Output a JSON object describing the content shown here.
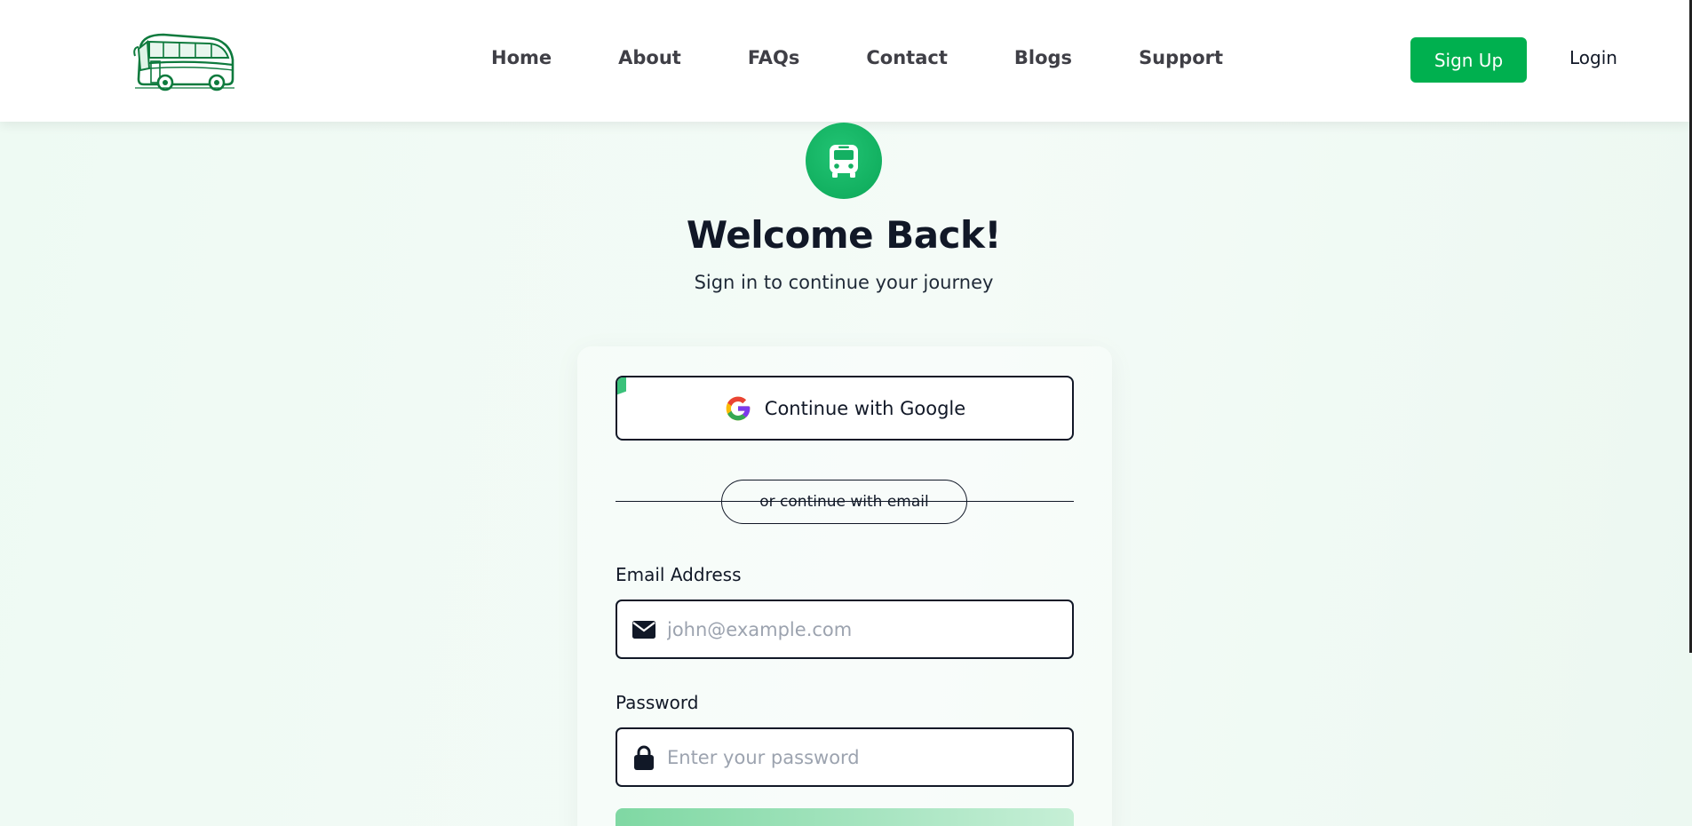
{
  "nav": {
    "links": [
      "Home",
      "About",
      "FAQs",
      "Contact",
      "Blogs",
      "Support"
    ],
    "signup_label": "Sign Up",
    "login_label": "Login"
  },
  "hero": {
    "title": "Welcome Back!",
    "subtitle": "Sign in to continue your journey"
  },
  "form": {
    "google_label": "Continue with Google",
    "divider_text": "or continue with email",
    "email": {
      "label": "Email Address",
      "placeholder": "john@example.com",
      "value": "",
      "icon": "envelope-icon"
    },
    "password": {
      "label": "Password",
      "placeholder": "Enter your password",
      "value": "",
      "icon": "lock-icon"
    }
  },
  "colors": {
    "brand_green": "#00b04f",
    "icon_green": "#12b060",
    "page_bg": "#eefaf3",
    "text_dark": "#111827",
    "placeholder": "#9ca3af"
  }
}
